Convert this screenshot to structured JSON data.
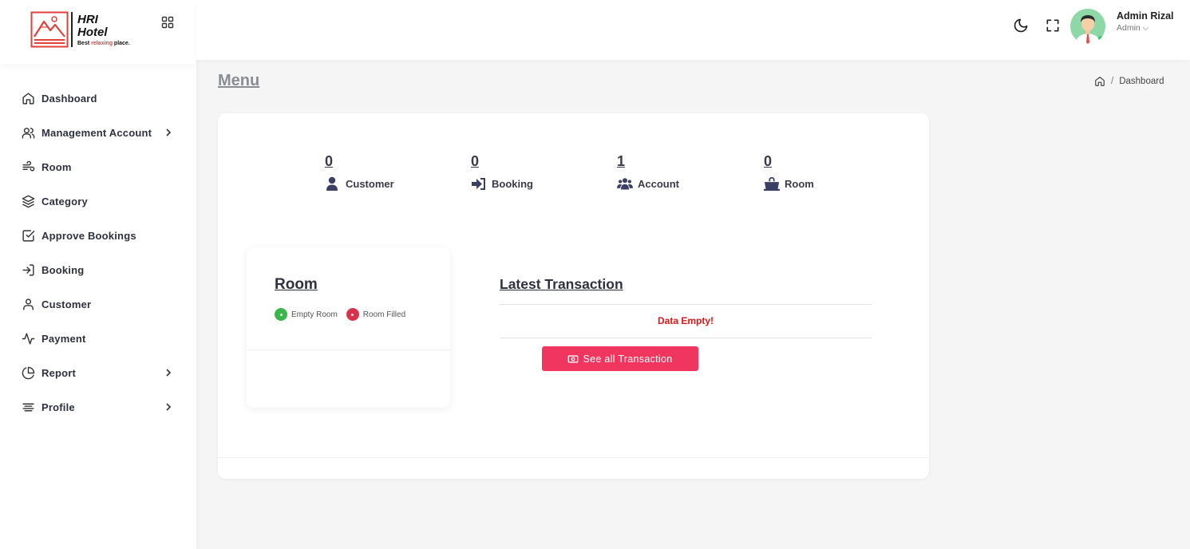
{
  "brand": {
    "line1": "HRI",
    "line2": "Hotel",
    "tagline_start": "Best ",
    "tagline_accent": "relaxing",
    "tagline_end": " place.",
    "accent_color": "#e0413a"
  },
  "sidebar": {
    "items": [
      {
        "label": "Dashboard",
        "icon": "home-icon"
      },
      {
        "label": "Management Account",
        "icon": "users-icon",
        "has_submenu": true
      },
      {
        "label": "Room",
        "icon": "wind-icon"
      },
      {
        "label": "Category",
        "icon": "layers-icon"
      },
      {
        "label": "Approve Bookings",
        "icon": "check-square-icon"
      },
      {
        "label": "Booking",
        "icon": "log-in-icon"
      },
      {
        "label": "Customer",
        "icon": "user-icon"
      },
      {
        "label": "Payment",
        "icon": "activity-icon"
      },
      {
        "label": "Report",
        "icon": "pie-chart-icon",
        "has_submenu": true
      },
      {
        "label": "Profile",
        "icon": "align-icon",
        "has_submenu": true
      }
    ]
  },
  "topbar": {
    "user_name": "Admin Rizal",
    "user_role": "Admin ⌵"
  },
  "page": {
    "title": "Menu",
    "breadcrumb_sep": "/",
    "breadcrumb_current": "Dashboard"
  },
  "stats": [
    {
      "value": "0",
      "label": "Customer",
      "icon": "user-solid-icon"
    },
    {
      "value": "0",
      "label": "Booking",
      "icon": "sign-in-solid-icon"
    },
    {
      "value": "1",
      "label": "Account",
      "icon": "users-solid-icon"
    },
    {
      "value": "0",
      "label": "Room",
      "icon": "shopping-bag-icon"
    }
  ],
  "room_card": {
    "title": "Room",
    "legend": [
      {
        "label": "Empty Room",
        "color": "#3bb44a"
      },
      {
        "label": "Room Filled",
        "color": "#d8334a"
      }
    ]
  },
  "transactions": {
    "title": "Latest Transaction",
    "empty_text": "Data Empty!",
    "button_label": "See all Transaction",
    "button_color": "#f0365f"
  },
  "colors": {
    "stat_icon": "#3b3f63",
    "danger_text": "#d81818"
  }
}
